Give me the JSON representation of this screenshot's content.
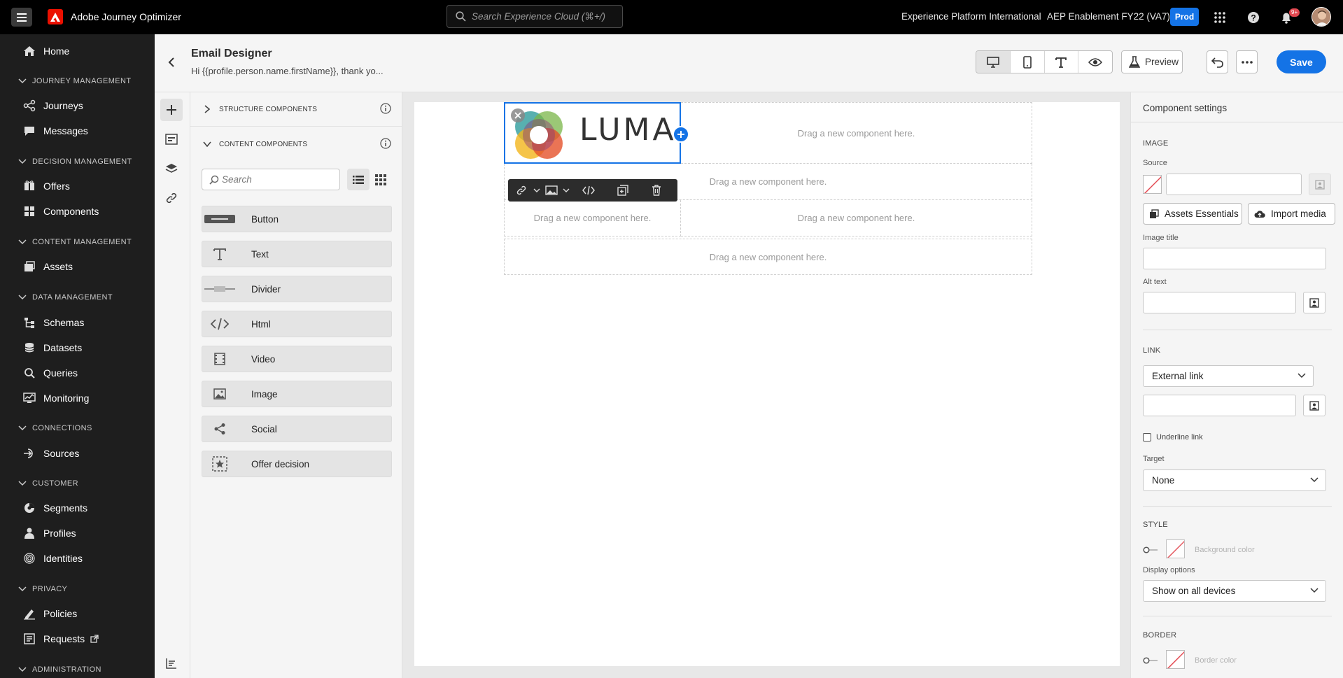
{
  "topbar": {
    "app_name": "Adobe Journey Optimizer",
    "search_placeholder": "Search Experience Cloud (⌘+/)",
    "org_name": "Experience Platform International",
    "sandbox_name": "AEP Enablement FY22 (VA7)",
    "environment_badge": "Prod",
    "notification_count": "9+"
  },
  "leftnav": {
    "home": "Home",
    "sections": [
      {
        "title": "JOURNEY MANAGEMENT",
        "items": [
          "Journeys",
          "Messages"
        ]
      },
      {
        "title": "DECISION MANAGEMENT",
        "items": [
          "Offers",
          "Components"
        ]
      },
      {
        "title": "CONTENT MANAGEMENT",
        "items": [
          "Assets"
        ]
      },
      {
        "title": "DATA MANAGEMENT",
        "items": [
          "Schemas",
          "Datasets",
          "Queries",
          "Monitoring"
        ]
      },
      {
        "title": "CONNECTIONS",
        "items": [
          "Sources"
        ]
      },
      {
        "title": "CUSTOMER",
        "items": [
          "Segments",
          "Profiles",
          "Identities"
        ]
      },
      {
        "title": "PRIVACY",
        "items": [
          "Policies",
          "Requests"
        ]
      },
      {
        "title": "ADMINISTRATION",
        "items": []
      }
    ]
  },
  "header": {
    "title": "Email Designer",
    "subtitle": "Hi {{profile.person.name.firstName}}, thank yo...",
    "preview_label": "Preview",
    "save_label": "Save"
  },
  "components_panel": {
    "structure_header": "STRUCTURE COMPONENTS",
    "content_header": "CONTENT COMPONENTS",
    "search_placeholder": "Search",
    "items": [
      "Button",
      "Text",
      "Divider",
      "Html",
      "Video",
      "Image",
      "Social",
      "Offer decision"
    ]
  },
  "canvas": {
    "logo_text": "LUMA",
    "drop_hint": "Drag a new component here."
  },
  "settings": {
    "title": "Component settings",
    "image_section": "IMAGE",
    "source_label": "Source",
    "assets_button": "Assets Essentials",
    "import_button": "Import media",
    "image_title_label": "Image title",
    "alt_text_label": "Alt text",
    "link_section": "LINK",
    "link_type": "External link",
    "underline_label": "Underline link",
    "target_label": "Target",
    "target_value": "None",
    "style_section": "STYLE",
    "background_color_label": "Background color",
    "display_options_label": "Display options",
    "display_options_value": "Show on all devices",
    "border_section": "BORDER",
    "border_color_label": "Border color"
  },
  "colors": {
    "accent": "#1473e6",
    "adobe_red": "#eb1000",
    "nav_bg": "#1e1e1e",
    "topbar_bg": "#000000"
  },
  "icons": {
    "nav": [
      "home-icon",
      "journeys-icon",
      "messages-icon",
      "offers-icon",
      "components-icon",
      "assets-icon",
      "schemas-icon",
      "datasets-icon",
      "queries-icon",
      "monitoring-icon",
      "sources-icon",
      "segments-icon",
      "profiles-icon",
      "identities-icon",
      "policies-icon",
      "requests-icon"
    ]
  }
}
